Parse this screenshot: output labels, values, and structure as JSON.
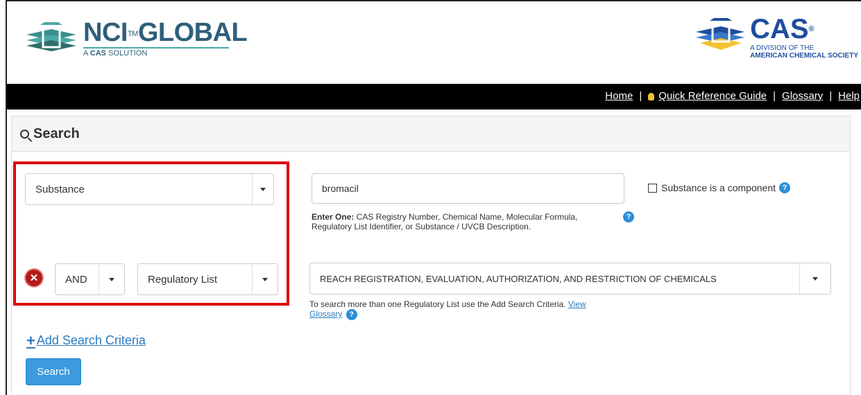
{
  "header": {
    "nci_logo": {
      "title": "NCI",
      "tm": "TM",
      "title2": "GLOBAL",
      "sub_prefix": "A ",
      "sub_bold": "CAS",
      "sub_suffix": " SOLUTION"
    },
    "cas_logo": {
      "title": "CAS",
      "reg": "®",
      "line1": "A DIVISION OF THE",
      "line2": "AMERICAN CHEMICAL SOCIETY"
    }
  },
  "nav": {
    "home": "Home",
    "sep": "|",
    "quick_ref": "Quick Reference Guide",
    "glossary": "Glossary",
    "help": "Help"
  },
  "search": {
    "title": "Search",
    "criteria1": {
      "field": "Substance",
      "value": "bromacil",
      "hint_bold": "Enter One:",
      "hint": " CAS Registry Number, Chemical Name, Molecular Formula, Regulatory List Identifier, or Substance / UVCB Description."
    },
    "component_label": "Substance is a component",
    "criteria2": {
      "operator": "AND",
      "field": "Regulatory List",
      "value": "REACH REGISTRATION, EVALUATION, AUTHORIZATION, AND RESTRICTION OF CHEMICALS",
      "hint": "To search more than one Regulatory List use the Add Search Criteria. ",
      "glossary_link": "View Glossary"
    },
    "add_criteria": "Add Search Criteria",
    "search_button": "Search",
    "help_glyph": "?",
    "remove_glyph": "✕"
  },
  "colors": {
    "brand_blue": "#1f4e9e",
    "teal": "#4aa9a6",
    "highlight": "#e0000e",
    "button": "#3b9ae0"
  }
}
